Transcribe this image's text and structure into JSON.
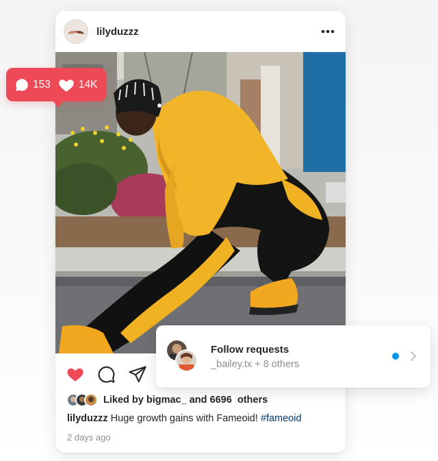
{
  "post": {
    "username": "lilyduzzz",
    "likes_prefix": "Liked by ",
    "likes_user": "bigmac_",
    "likes_suffix": " and 6696  others",
    "caption_user": "lilyduzzz",
    "caption_text": " Huge growth gains with Fameoid! ",
    "caption_hashtag": "#fameoid",
    "timestamp": "2 days ago",
    "liked": true
  },
  "notification": {
    "comments_count": "153",
    "likes_count": "14K",
    "color": "#ed4956"
  },
  "follow_requests": {
    "title": "Follow requests",
    "subtitle": "_bailey.tx + 8 others",
    "unread_dot_color": "#0095f6"
  },
  "icons": {
    "more": "more-horizontal-icon",
    "like": "heart-filled-icon",
    "comment": "comment-icon",
    "share": "share-paper-plane-icon",
    "chevron": "chevron-right-icon"
  },
  "colors": {
    "accent_red": "#ed4956",
    "link_blue": "#00376b",
    "dot_blue": "#0095f6",
    "muted": "#8e8e8e"
  }
}
